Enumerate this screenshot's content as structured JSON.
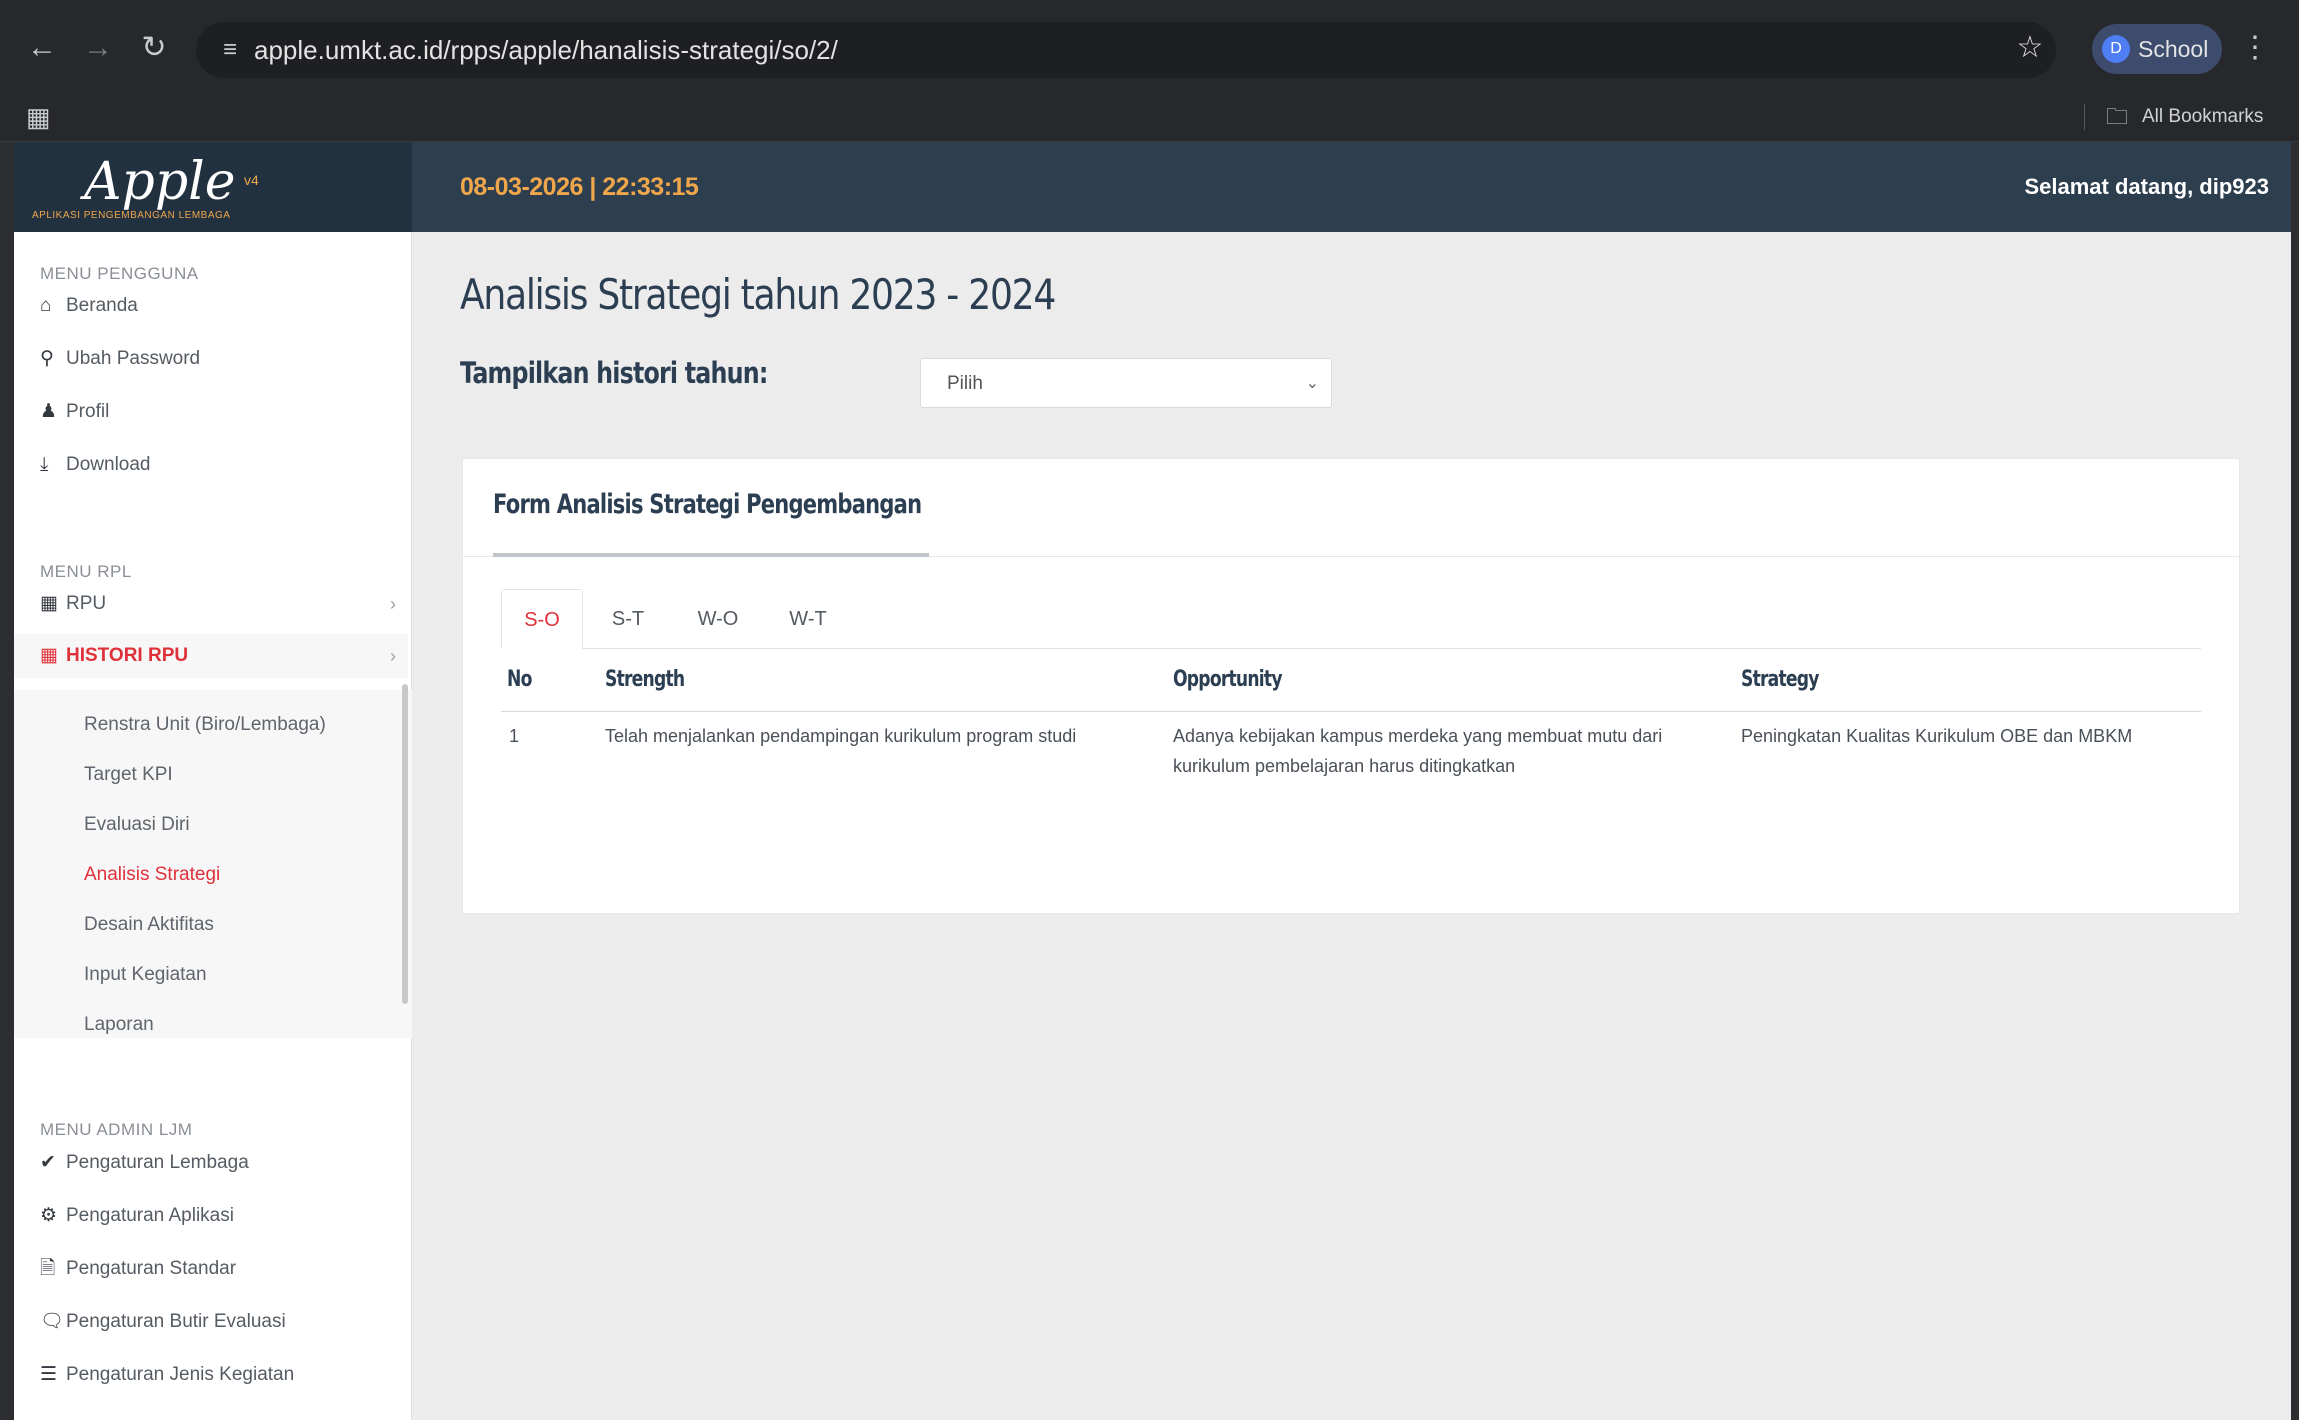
{
  "browser": {
    "url": "apple.umkt.ac.id/rpps/apple/hanalisis-strategi/so/2/",
    "profile_initial": "D",
    "profile_label": "School",
    "bookmarks_label": "All Bookmarks"
  },
  "header": {
    "logo_text": "Apple",
    "logo_version": "v4",
    "logo_subtitle": "APLIKASI PENGEMBANGAN LEMBAGA",
    "datetime": "08-03-2026 | 22:33:15",
    "welcome": "Selamat datang, dip923"
  },
  "sidebar": {
    "section_user": "MENU PENGGUNA",
    "user_items": [
      "Beranda",
      "Ubah Password",
      "Profil",
      "Download"
    ],
    "section_rpl": "MENU RPL",
    "rpl_items": [
      "RPU",
      "HISTORI RPU"
    ],
    "histori_subitems": [
      "Renstra Unit (Biro/Lembaga)",
      "Target KPI",
      "Evaluasi Diri",
      "Analisis Strategi",
      "Desain Aktifitas",
      "Input Kegiatan",
      "Laporan"
    ],
    "section_admin": "MENU ADMIN LJM",
    "admin_items": [
      "Pengaturan Lembaga",
      "Pengaturan Aplikasi",
      "Pengaturan Standar",
      "Pengaturan Butir Evaluasi",
      "Pengaturan Jenis Kegiatan"
    ]
  },
  "main": {
    "title": "Analisis Strategi tahun 2023 - 2024",
    "history_label": "Tampilkan histori tahun:",
    "history_select_value": "Pilih",
    "card_title": "Form Analisis Strategi Pengembangan",
    "tabs": [
      "S-O",
      "S-T",
      "W-O",
      "W-T"
    ],
    "active_tab": "S-O",
    "table": {
      "headers": [
        "No",
        "Strength",
        "Opportunity",
        "Strategy"
      ],
      "rows": [
        [
          "1",
          "Telah menjalankan pendampingan kurikulum program studi",
          "Adanya kebijakan kampus merdeka yang membuat mutu dari kurikulum pembelajaran harus ditingkatkan",
          "Peningkatan Kualitas Kurikulum OBE dan MBKM"
        ]
      ]
    }
  },
  "colors": {
    "header_bg": "#2d3f4f",
    "accent_orange": "#f0a64b",
    "active_red": "#e0313b",
    "heading_navy": "#2c3e52"
  }
}
